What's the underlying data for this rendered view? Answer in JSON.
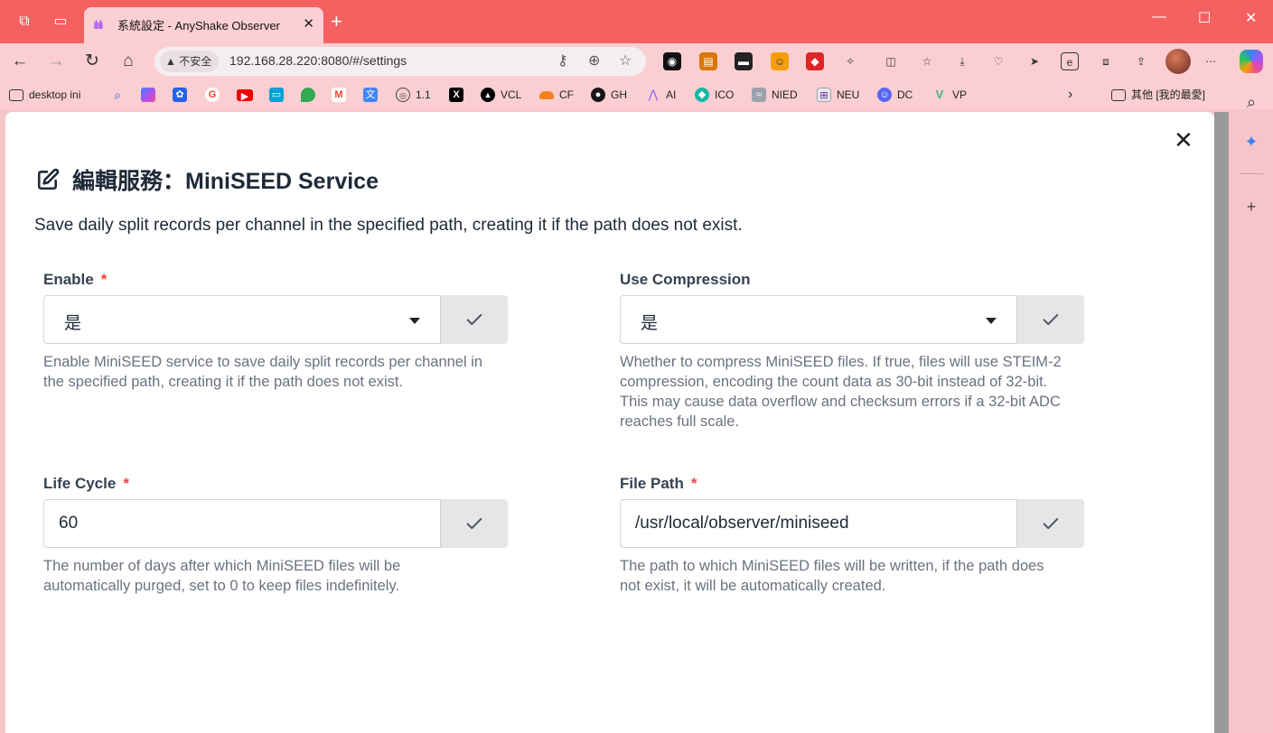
{
  "browser": {
    "tab": {
      "title": "系統設定 - AnyShake Observer",
      "close": "✕"
    },
    "new_tab": "+",
    "window_controls": {
      "minimize": "—",
      "maximize": "☐",
      "close": "✕"
    },
    "address": {
      "security_label": "不安全",
      "url": "192.168.28.220:8080/#/settings"
    },
    "bookmarks": [
      {
        "label": "desktop ini",
        "icon": "folder-icon",
        "color": "#444444"
      },
      {
        "label": "",
        "icon": "search-icon",
        "color": "#2563eb"
      },
      {
        "label": "",
        "icon": "copilot-icon",
        "color": "#a855f7"
      },
      {
        "label": "",
        "icon": "baidu-icon",
        "color": "#2563eb"
      },
      {
        "label": "",
        "icon": "google-icon",
        "color": "#ea4335"
      },
      {
        "label": "",
        "icon": "youtube-icon",
        "color": "#ef0000"
      },
      {
        "label": "",
        "icon": "bilibili-icon",
        "color": "#00a1d6"
      },
      {
        "label": "",
        "icon": "maps-icon",
        "color": "#34a853"
      },
      {
        "label": "",
        "icon": "gmail-icon",
        "color": "#ea4335"
      },
      {
        "label": "",
        "icon": "translate-icon",
        "color": "#4285f4"
      },
      {
        "label": "1.1",
        "icon": "globe-icon",
        "color": "#444444"
      },
      {
        "label": "",
        "icon": "x-icon",
        "color": "#000000"
      },
      {
        "label": "VCL",
        "icon": "vercel-icon",
        "color": "#000000"
      },
      {
        "label": "CF",
        "icon": "cloudflare-icon",
        "color": "#f38020"
      },
      {
        "label": "GH",
        "icon": "github-icon",
        "color": "#181717"
      },
      {
        "label": "AI",
        "icon": "ai-icon",
        "color": "#8b5cf6"
      },
      {
        "label": "ICO",
        "icon": "ico-icon",
        "color": "#14b8a6"
      },
      {
        "label": "NIED",
        "icon": "nied-icon",
        "color": "#9ca3af"
      },
      {
        "label": "NEU",
        "icon": "neu-icon",
        "color": "#9ca3af"
      },
      {
        "label": "DC",
        "icon": "discord-icon",
        "color": "#5865f2"
      },
      {
        "label": "VP",
        "icon": "vue-icon",
        "color": "#42b883"
      }
    ],
    "other_bookmarks": "其他 [我的最愛]"
  },
  "dialog": {
    "title": "編輯服務：MiniSEED Service",
    "description": "Save daily split records per channel in the specified path, creating it if the path does not exist.",
    "close": "✕",
    "fields": {
      "enable": {
        "label": "Enable",
        "required_mark": "*",
        "value": "是",
        "help": "Enable MiniSEED service to save daily split records per channel in the specified path, creating it if the path does not exist."
      },
      "use_compression": {
        "label": "Use Compression",
        "value": "是",
        "help": "Whether to compress MiniSEED files. If true, files will use STEIM-2 compression, encoding the count data as 30-bit instead of 32-bit. This may cause data overflow and checksum errors if a 32-bit ADC reaches full scale."
      },
      "life_cycle": {
        "label": "Life Cycle",
        "required_mark": "*",
        "value": "60",
        "help": "The number of days after which MiniSEED files will be automatically purged, set to 0 to keep files indefinitely."
      },
      "file_path": {
        "label": "File Path",
        "required_mark": "*",
        "value": "/usr/local/observer/miniseed",
        "help": "The path to which MiniSEED files will be written, if the path does not exist, it will be automatically created."
      }
    }
  },
  "colors": {
    "tabstrip": "#f56161",
    "toolbar": "#fbcfd1",
    "required": "#ef4444",
    "confirm_bg": "#e6e6e6"
  }
}
